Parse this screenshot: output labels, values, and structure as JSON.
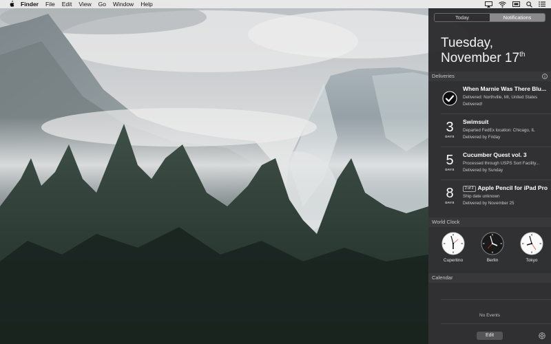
{
  "menubar": {
    "app_name": "Finder",
    "items": [
      "File",
      "Edit",
      "View",
      "Go",
      "Window",
      "Help"
    ],
    "icons": [
      "airplay-icon",
      "wifi-icon",
      "screen-mirroring-icon",
      "search-icon",
      "notification-center-icon"
    ]
  },
  "panel": {
    "tabs": {
      "today": "Today",
      "notifications": "Notifications"
    },
    "date": {
      "weekday": "Tuesday,",
      "month_day": "November 17",
      "suffix": "th"
    },
    "deliveries": {
      "header": "Deliveries",
      "items": [
        {
          "status_icon": "checkmark-icon",
          "title": "When Marnie Was There Blu...",
          "line1": "Delivered: Northville, MI, United States",
          "line2": "Delivered!"
        },
        {
          "days": "3",
          "unit": "DAYS",
          "title": "Swimsuit",
          "line1": "Departed FedEx location: Chicago, IL",
          "line2": "Delivered by Friday"
        },
        {
          "days": "5",
          "unit": "DAYS",
          "title": "Cucumber Quest vol. 3",
          "line1": "Processed through USPS Sort Facility...",
          "line2": "Delivered by Sunday"
        },
        {
          "days": "8",
          "unit": "DAYS",
          "badge": "2 of 2",
          "title": "Apple Pencil for iPad Pro",
          "line1": "Ship date unknown",
          "line2": "Delivered by November 25"
        }
      ]
    },
    "world_clock": {
      "header": "World Clock",
      "clocks": [
        {
          "label": "Cupertino",
          "face": "light"
        },
        {
          "label": "Berlin",
          "face": "dark"
        },
        {
          "label": "Tokyo",
          "face": "light"
        }
      ]
    },
    "calendar": {
      "header": "Calendar",
      "empty": "No Events"
    },
    "edit_label": "Edit"
  }
}
